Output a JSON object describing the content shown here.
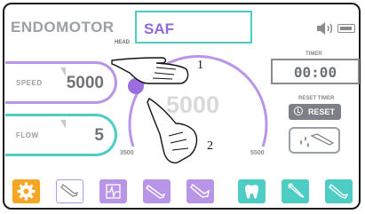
{
  "header": {
    "title": "ENDOMOTOR",
    "head_label": "HEAD",
    "head_value": "SAF",
    "sound_icon": "speaker-icon",
    "battery_icon": "battery-icon"
  },
  "controls": {
    "speed": {
      "label": "SPEED",
      "value": "5000"
    },
    "flow": {
      "label": "FLOW",
      "value": "5"
    }
  },
  "dial": {
    "rpm_display": "5000",
    "min_label": "3500",
    "max_label": "5500",
    "level_fraction": 0.0
  },
  "timer": {
    "label": "TIMER",
    "value": "00:00",
    "reset_label": "RESET TIMER",
    "reset_button": "RESET"
  },
  "annotations": {
    "pointer_1": "1",
    "pointer_2": "2"
  },
  "toolbar": {
    "items": [
      {
        "name": "settings",
        "icon": "gear-icon",
        "color": "#f5a623"
      },
      {
        "name": "handpiece-outline",
        "icon": "handpiece-icon"
      },
      {
        "name": "apex-locator",
        "icon": "apex-icon"
      },
      {
        "name": "straight-handpiece",
        "icon": "handpiece-icon"
      },
      {
        "name": "contra-angle",
        "icon": "handpiece-icon"
      },
      {
        "name": "tooth",
        "icon": "tooth-icon"
      },
      {
        "name": "scaler",
        "icon": "handpiece-icon"
      },
      {
        "name": "surgical",
        "icon": "handpiece-icon"
      }
    ]
  },
  "colors": {
    "accent_purple": "#b995e8",
    "accent_teal": "#4ecdc4",
    "accent_orange": "#f5a623",
    "text_gray": "#6f7378"
  }
}
